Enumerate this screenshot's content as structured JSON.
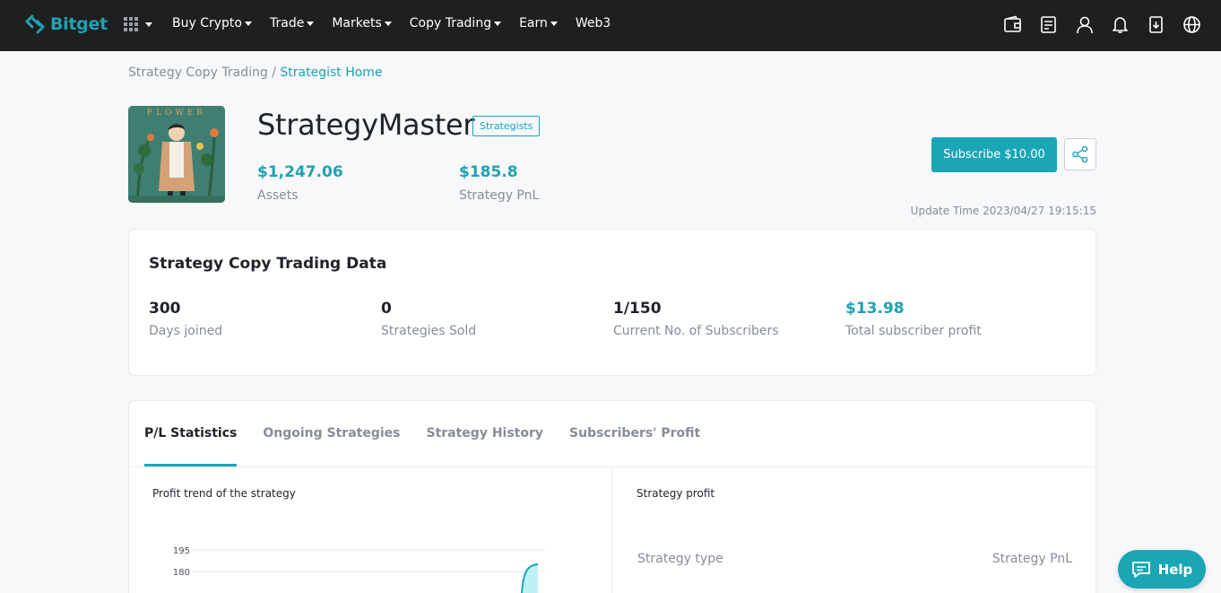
{
  "colors": {
    "accent": "#1da2b4",
    "nav_bg": "#1f1f1f",
    "muted": "#868d97",
    "text": "#1f2329"
  },
  "brand": {
    "name": "Bitget"
  },
  "nav": {
    "items": [
      {
        "label": "Buy Crypto",
        "caret": true
      },
      {
        "label": "Trade",
        "caret": true
      },
      {
        "label": "Markets",
        "caret": true
      },
      {
        "label": "Copy Trading",
        "caret": true
      },
      {
        "label": "Earn",
        "caret": true
      },
      {
        "label": "Web3",
        "caret": false
      }
    ],
    "right_icons": [
      "wallet-icon",
      "orders-icon",
      "user-icon",
      "bell-icon",
      "download-icon",
      "globe-icon"
    ]
  },
  "breadcrumb": {
    "root": "Strategy Copy Trading",
    "separator": " / ",
    "current": "Strategist Home"
  },
  "profile": {
    "avatar_text": "FLOWER",
    "name": "StrategyMaster",
    "badge": "Strategists",
    "assets_value": "$1,247.06",
    "assets_label": "Assets",
    "pnl_value": "$185.8",
    "pnl_label": "Strategy PnL",
    "subscribe_label": "Subscribe $10.00",
    "update_time": "Update Time 2023/04/27 19:15:15"
  },
  "copy_data": {
    "title": "Strategy Copy Trading Data",
    "metrics": [
      {
        "value": "300",
        "label": "Days joined"
      },
      {
        "value": "0",
        "label": "Strategies Sold"
      },
      {
        "value": "1/150",
        "label": "Current No. of Subscribers"
      },
      {
        "value": "$13.98",
        "label": "Total subscriber profit"
      }
    ]
  },
  "tabs": [
    {
      "label": "P/L Statistics",
      "active": true
    },
    {
      "label": "Ongoing Strategies",
      "active": false
    },
    {
      "label": "Strategy History",
      "active": false
    },
    {
      "label": "Subscribers' Profit",
      "active": false
    }
  ],
  "profit_trend": {
    "title": "Profit trend of the strategy",
    "y_ticks": [
      "195",
      "180"
    ]
  },
  "strategy_profit": {
    "title": "Strategy profit",
    "col_type": "Strategy type",
    "col_pnl": "Strategy PnL"
  },
  "help": {
    "label": "Help"
  }
}
